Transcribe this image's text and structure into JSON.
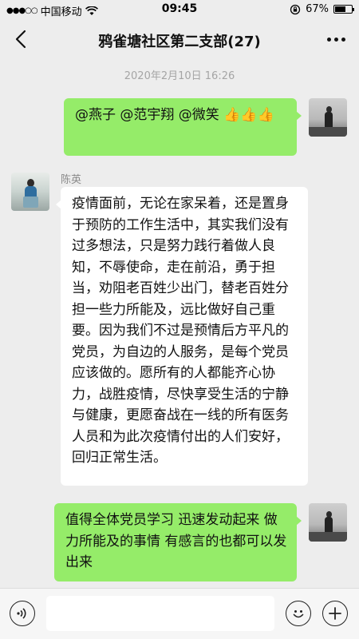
{
  "status_bar": {
    "carrier": "中国移动",
    "time": "09:45",
    "battery_percent": "67%",
    "battery_level": 0.67,
    "icons": [
      "signal-dots-icon",
      "wifi-icon",
      "rotation-lock-icon",
      "battery-icon"
    ]
  },
  "nav": {
    "title": "鸦雀塘社区第二支部(27)",
    "icons": [
      "back-arrow-icon",
      "more-icon"
    ]
  },
  "chat": {
    "timestamp": "2020年2月10日 16:26",
    "messages": [
      {
        "from": "me",
        "text": "@燕子 @范宇翔 @微笑 ",
        "emoji": "👍👍👍"
      },
      {
        "from": "other",
        "sender": "陈英",
        "text": "疫情面前，无论在家呆着，还是置身于预防的工作生活中，其实我们没有过多想法，只是努力践行着做人良知，不辱使命，走在前沿，勇于担当，劝阻老百姓少出门，替老百姓分担一些力所能及，远比做好自己重要。因为我们不过是预情后方平凡的党员，为自边的人服务，是每个党员应该做的。愿所有的人都能齐心协力，战胜疫情，尽快享受生活的宁静与健康，更愿奋战在一线的所有医务人员和为此次疫情付出的人们安好，回归正常生活。"
      },
      {
        "from": "me",
        "text": "值得全体党员学习  迅速发动起来 做力所能及的事情 有感言的也都可以发出来"
      }
    ]
  },
  "input_bar": {
    "icons": [
      "voice-icon",
      "emoji-icon",
      "plus-icon"
    ],
    "placeholder": ""
  },
  "colors": {
    "background": "#ededed",
    "my_bubble": "#95ec69",
    "other_bubble": "#ffffff",
    "timestamp": "#a5a5a5"
  }
}
